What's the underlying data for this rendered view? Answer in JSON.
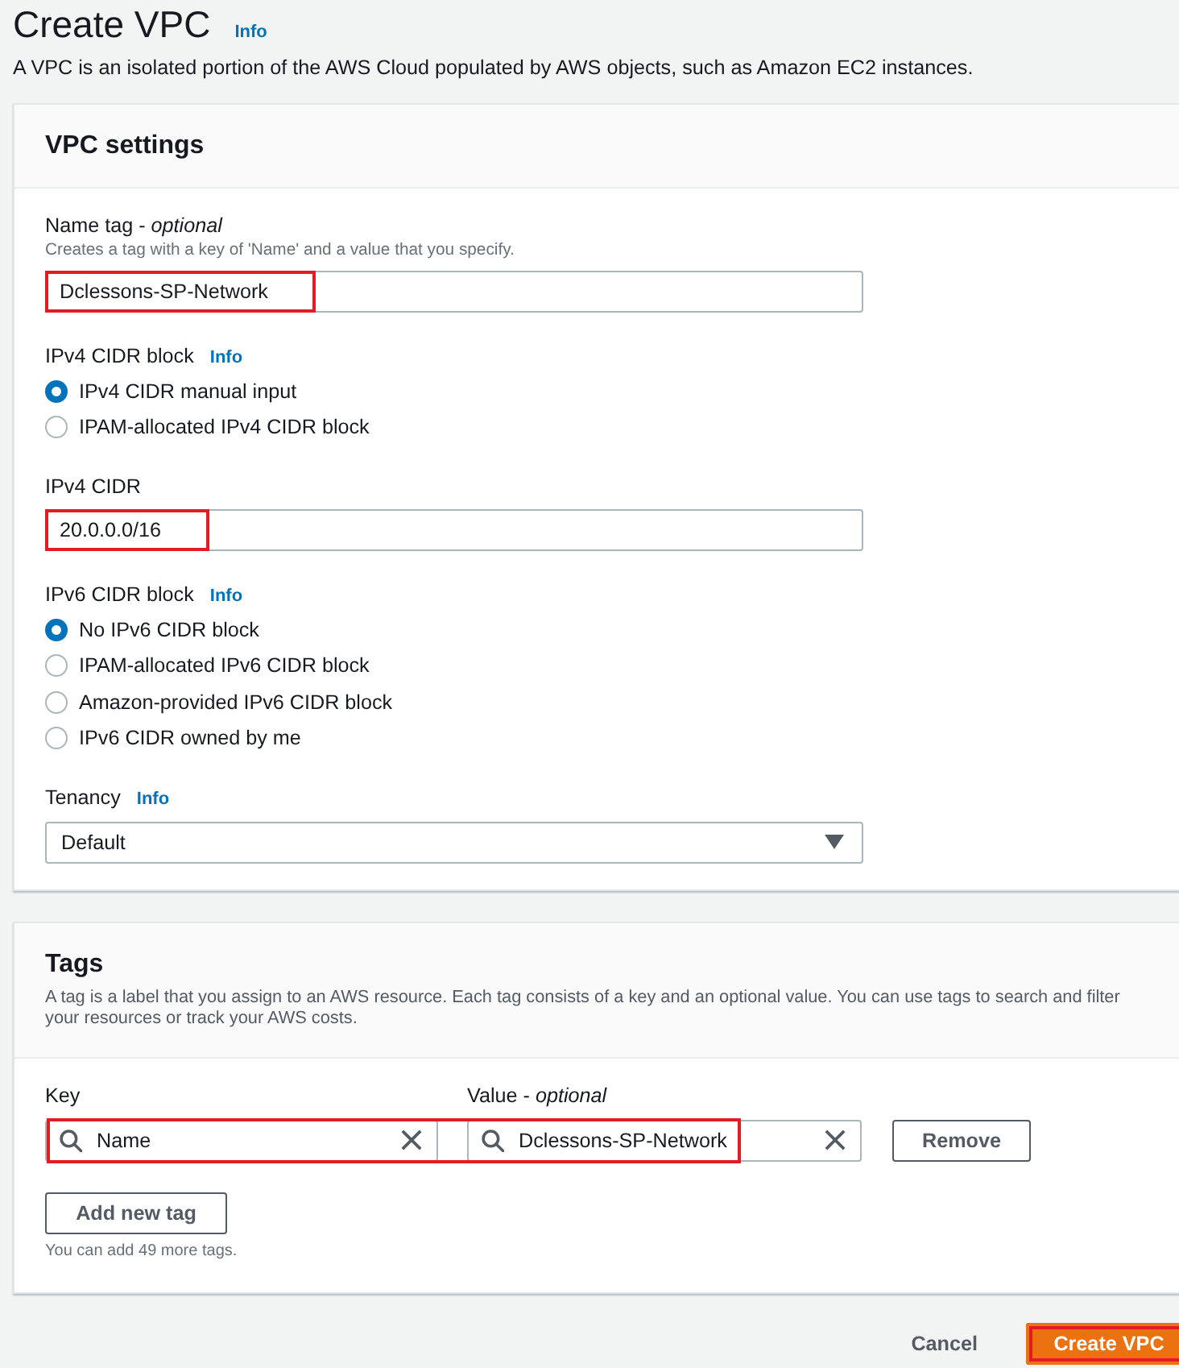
{
  "page": {
    "title": "Create VPC",
    "info_link": "Info",
    "description": "A VPC is an isolated portion of the AWS Cloud populated by AWS objects, such as Amazon EC2 instances."
  },
  "vpc_settings": {
    "title": "VPC settings",
    "fields": [
      {
        "kind": "text",
        "label": "Name tag - *optional*",
        "description": "Creates a tag with a key of 'Name' and a value that you specify.",
        "value": "Dclessons-SP-Network",
        "highlighted": true
      },
      {
        "kind": "radio",
        "label": "IPv4 CIDR block",
        "info_link": "Info",
        "options": [
          {
            "label": "IPv4 CIDR manual input",
            "selected": true
          },
          {
            "label": "IPAM-allocated IPv4 CIDR block",
            "selected": false
          }
        ]
      },
      {
        "kind": "text",
        "label": "IPv4 CIDR",
        "value": "20.0.0.0/16",
        "highlighted": true
      },
      {
        "kind": "radio",
        "label": "IPv6 CIDR block",
        "info_link": "Info",
        "options": [
          {
            "label": "No IPv6 CIDR block",
            "selected": true
          },
          {
            "label": "IPAM-allocated IPv6 CIDR block",
            "selected": false
          },
          {
            "label": "Amazon-provided IPv6 CIDR block",
            "selected": false
          },
          {
            "label": "IPv6 CIDR owned by me",
            "selected": false
          }
        ]
      },
      {
        "kind": "select",
        "label": "Tenancy",
        "info_link": "Info",
        "value": "Default"
      }
    ]
  },
  "tags": {
    "title": "Tags",
    "description": "A tag is a label that you assign to an AWS resource. Each tag consists of a key and an optional value. You can use tags to search and filter your resources or track your AWS costs.",
    "key_label": "Key",
    "value_label": "Value - *optional*",
    "rows": [
      {
        "key": "Name",
        "value": "Dclessons-SP-Network",
        "highlighted": true,
        "remove_button": "Remove"
      }
    ],
    "add_button": "Add new tag",
    "hint": "You can add 49 more tags."
  },
  "actions": {
    "cancel": "Cancel",
    "submit": {
      "label": "Create VPC",
      "highlighted": true
    }
  }
}
